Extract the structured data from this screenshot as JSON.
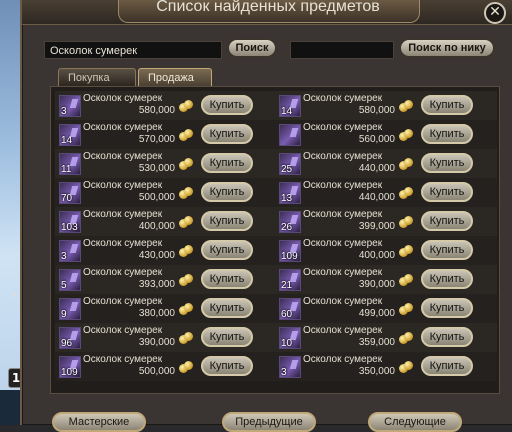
{
  "window": {
    "title": "Список найденных предметов",
    "close_symbol": "✕"
  },
  "search": {
    "query_value": "Осколок сумерек",
    "search_button": "Поиск",
    "nick_value": "",
    "nick_button": "Поиск по нику"
  },
  "tabs": [
    {
      "label": "Покупка",
      "active": false
    },
    {
      "label": "Продажа",
      "active": true
    }
  ],
  "buy_label": "Купить",
  "left_items": [
    {
      "name": "Осколок сумерек",
      "count": "3",
      "price": "580,000"
    },
    {
      "name": "Осколок сумерек",
      "count": "14",
      "price": "570,000"
    },
    {
      "name": "Осколок сумерек",
      "count": "11",
      "price": "530,000"
    },
    {
      "name": "Осколок сумерек",
      "count": "70",
      "price": "500,000"
    },
    {
      "name": "Осколок сумерек",
      "count": "103",
      "price": "400,000"
    },
    {
      "name": "Осколок сумерек",
      "count": "3",
      "price": "430,000"
    },
    {
      "name": "Осколок сумерек",
      "count": "5",
      "price": "393,000"
    },
    {
      "name": "Осколок сумерек",
      "count": "9",
      "price": "380,000"
    },
    {
      "name": "Осколок сумерек",
      "count": "96",
      "price": "390,000"
    },
    {
      "name": "Осколок сумерек",
      "count": "109",
      "price": "500,000"
    }
  ],
  "right_items": [
    {
      "name": "Осколок сумерек",
      "count": "14",
      "price": "580,000"
    },
    {
      "name": "Осколок сумерек",
      "count": "",
      "price": "560,000"
    },
    {
      "name": "Осколок сумерек",
      "count": "25",
      "price": "440,000"
    },
    {
      "name": "Осколок сумерек",
      "count": "13",
      "price": "440,000"
    },
    {
      "name": "Осколок сумерек",
      "count": "26",
      "price": "399,000"
    },
    {
      "name": "Осколок сумерек",
      "count": "109",
      "price": "400,000"
    },
    {
      "name": "Осколок сумерек",
      "count": "21",
      "price": "390,000"
    },
    {
      "name": "Осколок сумерек",
      "count": "60",
      "price": "499,000"
    },
    {
      "name": "Осколок сумерек",
      "count": "10",
      "price": "359,000"
    },
    {
      "name": "Осколок сумерек",
      "count": "3",
      "price": "350,000"
    }
  ],
  "bottom_buttons": [
    "Мастерские",
    "Предыдущие",
    "Следующие"
  ],
  "scene_badge": "1",
  "icons": {
    "item": "twilight-shard-icon",
    "currency": "adena-coins-icon",
    "close": "close-icon"
  }
}
